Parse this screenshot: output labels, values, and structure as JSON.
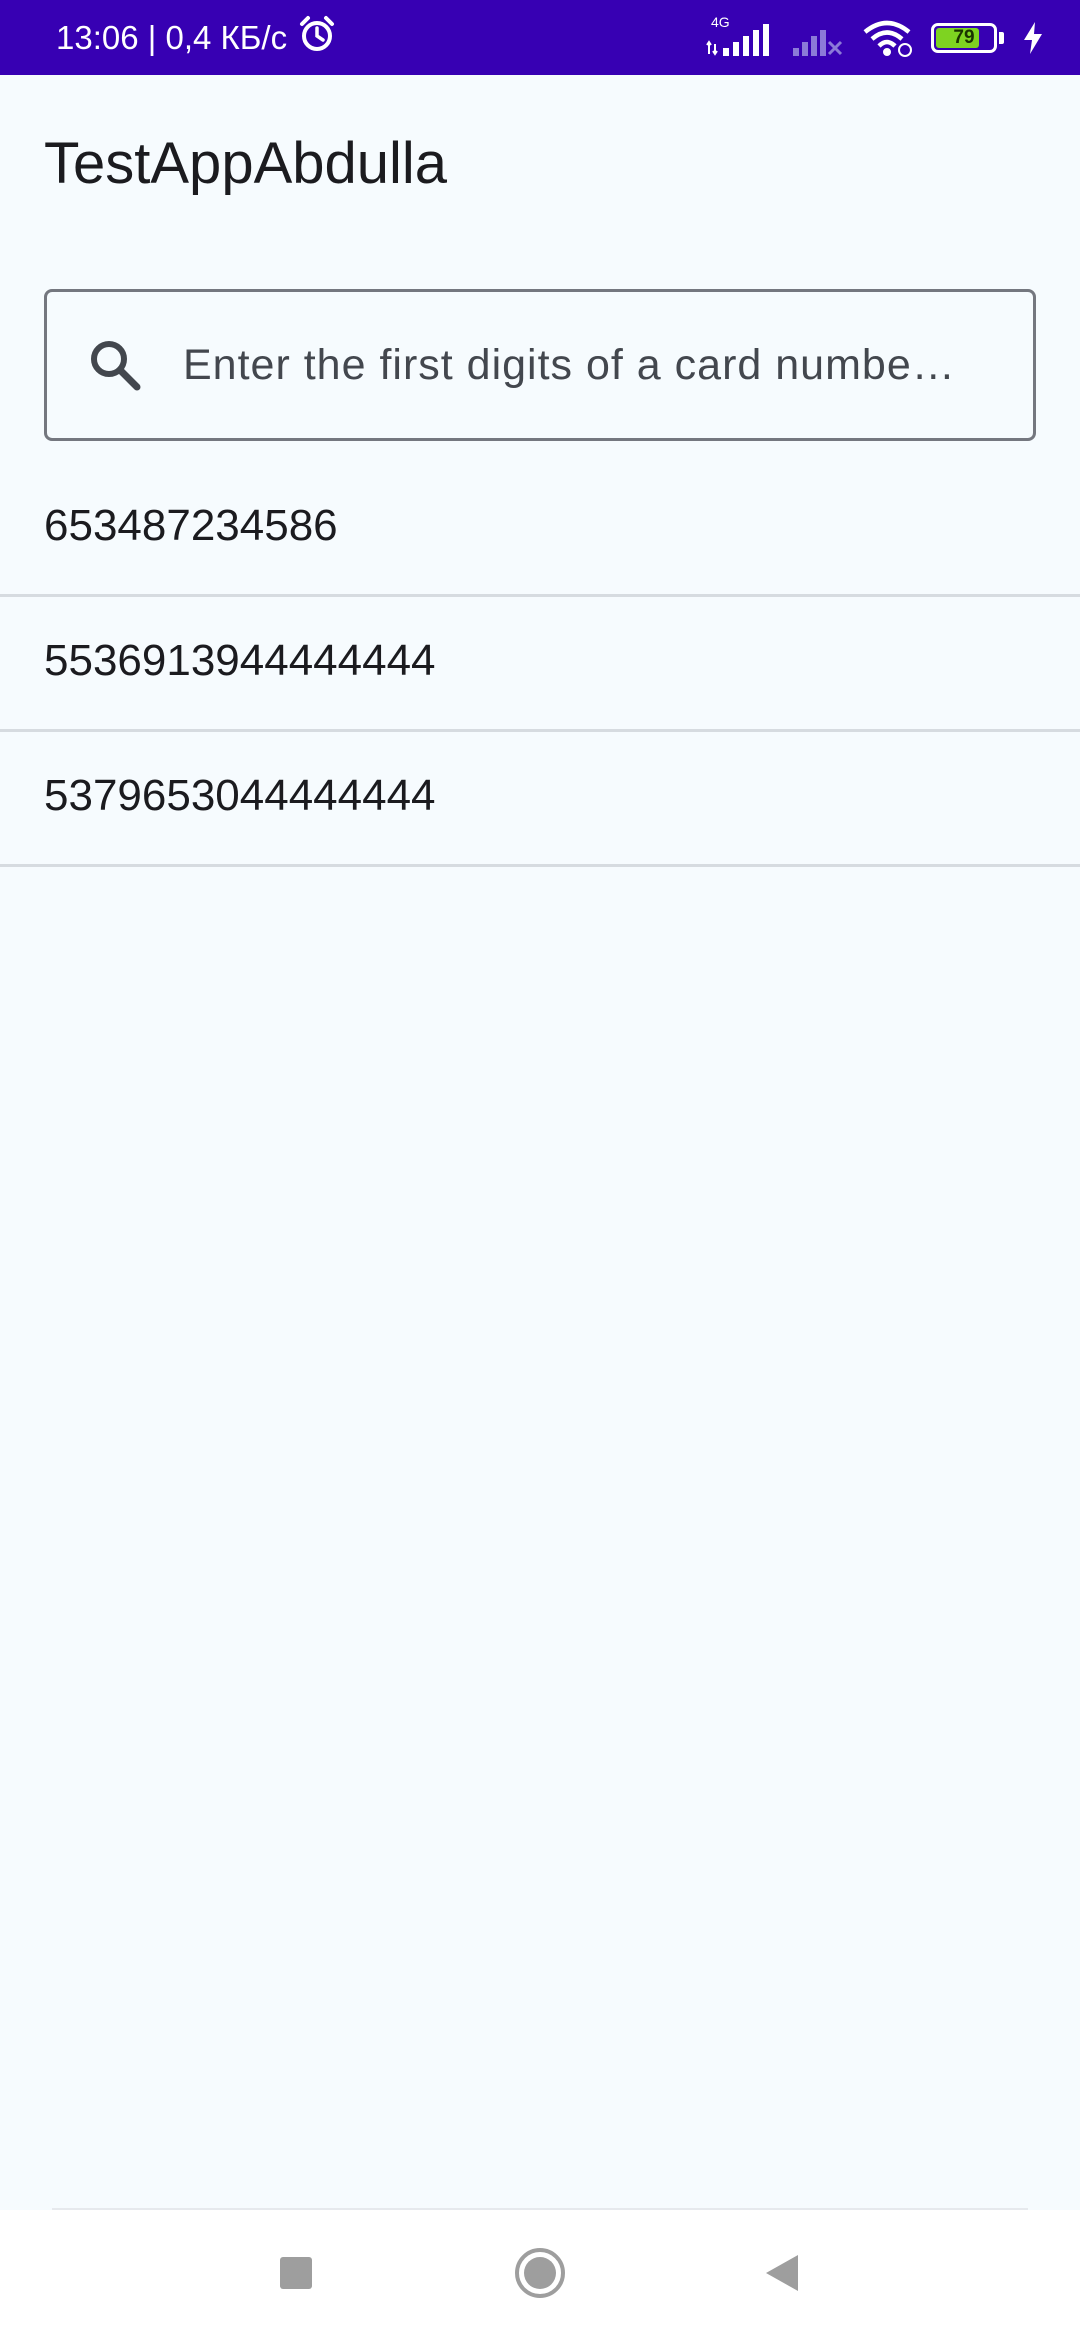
{
  "status_bar": {
    "time_and_speed": "13:06 | 0,4 КБ/с",
    "network_type": "4G",
    "battery_level": "79",
    "battery_fraction": 0.79,
    "background_color": "#3700b3"
  },
  "app": {
    "title": "TestAppAbdulla"
  },
  "search": {
    "placeholder": "Enter the first digits of a card numbe…",
    "value": "",
    "icon": "search-icon"
  },
  "cards": [
    "653487234586",
    "5536913944444444",
    "5379653044444444"
  ],
  "nav_bar": {
    "recent_icon": "square-icon",
    "home_icon": "circle-icon",
    "back_icon": "triangle-icon"
  }
}
